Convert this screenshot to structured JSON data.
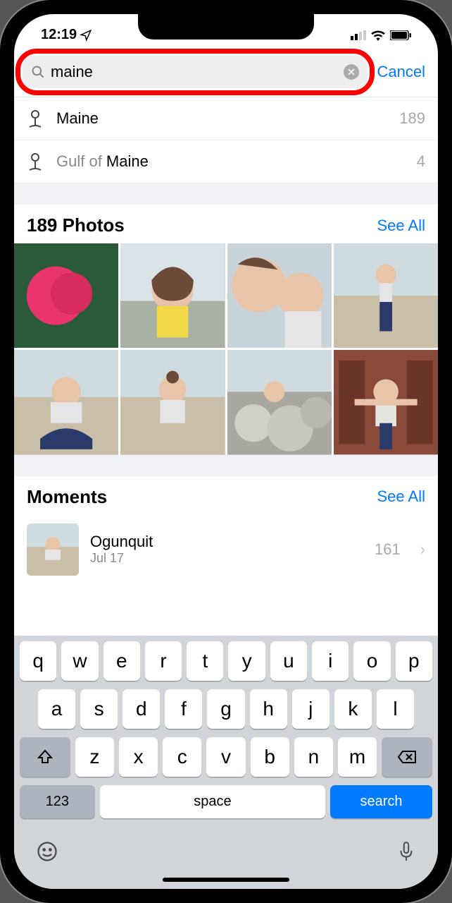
{
  "status": {
    "time": "12:19",
    "location_icon": "location-arrow",
    "signal_bars": 3,
    "wifi": true,
    "battery": true
  },
  "search": {
    "value": "maine",
    "cancel_label": "Cancel"
  },
  "suggestions": [
    {
      "prefix": "",
      "match": "Maine",
      "count": "189"
    },
    {
      "prefix": "Gulf of ",
      "match": "Maine",
      "count": "4"
    }
  ],
  "photos": {
    "header": "189 Photos",
    "see_all": "See All"
  },
  "moments": {
    "header": "Moments",
    "see_all": "See All",
    "items": [
      {
        "title": "Ogunquit",
        "date": "Jul 17",
        "count": "161"
      }
    ]
  },
  "keyboard": {
    "row1": [
      "q",
      "w",
      "e",
      "r",
      "t",
      "y",
      "u",
      "i",
      "o",
      "p"
    ],
    "row2": [
      "a",
      "s",
      "d",
      "f",
      "g",
      "h",
      "j",
      "k",
      "l"
    ],
    "row3": [
      "z",
      "x",
      "c",
      "v",
      "b",
      "n",
      "m"
    ],
    "num_key": "123",
    "space_key": "space",
    "action_key": "search"
  }
}
